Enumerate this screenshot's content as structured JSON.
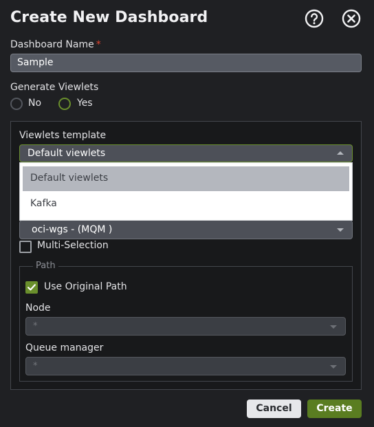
{
  "dialog": {
    "title": "Create New Dashboard",
    "help_icon": "help-circle-icon",
    "close_icon": "close-circle-icon"
  },
  "dashboard_name": {
    "label": "Dashboard Name",
    "required_mark": "*",
    "value": "Sample"
  },
  "generate_viewlets": {
    "label": "Generate Viewlets",
    "options": [
      {
        "label": "No",
        "selected": false
      },
      {
        "label": "Yes",
        "selected": true
      }
    ]
  },
  "viewlets_template": {
    "label": "Viewlets template",
    "value": "Default viewlets",
    "options": [
      {
        "label": "Default viewlets",
        "selected": true
      },
      {
        "label": "Kafka",
        "selected": false
      }
    ]
  },
  "connection_select": {
    "value": "oci-wgs - (MQM )"
  },
  "multi_selection": {
    "label": "Multi-Selection",
    "checked": false
  },
  "path": {
    "legend": "Path",
    "use_original_path": {
      "label": "Use Original Path",
      "checked": true
    },
    "node": {
      "label": "Node",
      "value": "*"
    },
    "queue_manager": {
      "label": "Queue manager",
      "value": "*"
    }
  },
  "footer": {
    "cancel_label": "Cancel",
    "create_label": "Create"
  },
  "colors": {
    "background": "#1f2023",
    "accent": "#5a7d21",
    "required": "#e0442f"
  }
}
